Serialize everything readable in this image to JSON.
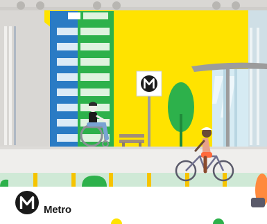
{
  "scene": {
    "colors": {
      "sky": "#ffffff",
      "structure": "#d9d7d4",
      "building_yellow": "#ffe300",
      "building_blue": "#2a7bc4",
      "building_green": "#2db14b",
      "platform": "#efeeec",
      "tree": "#2db14b",
      "accent": "#f6c400",
      "ink": "#1a1a1a"
    },
    "figures": [
      "wheelchair-user",
      "cyclist"
    ]
  },
  "station_sign": {
    "icon": "metro-m-icon"
  },
  "brand": {
    "icon": "metro-m-logo",
    "wordmark": "Metro"
  }
}
